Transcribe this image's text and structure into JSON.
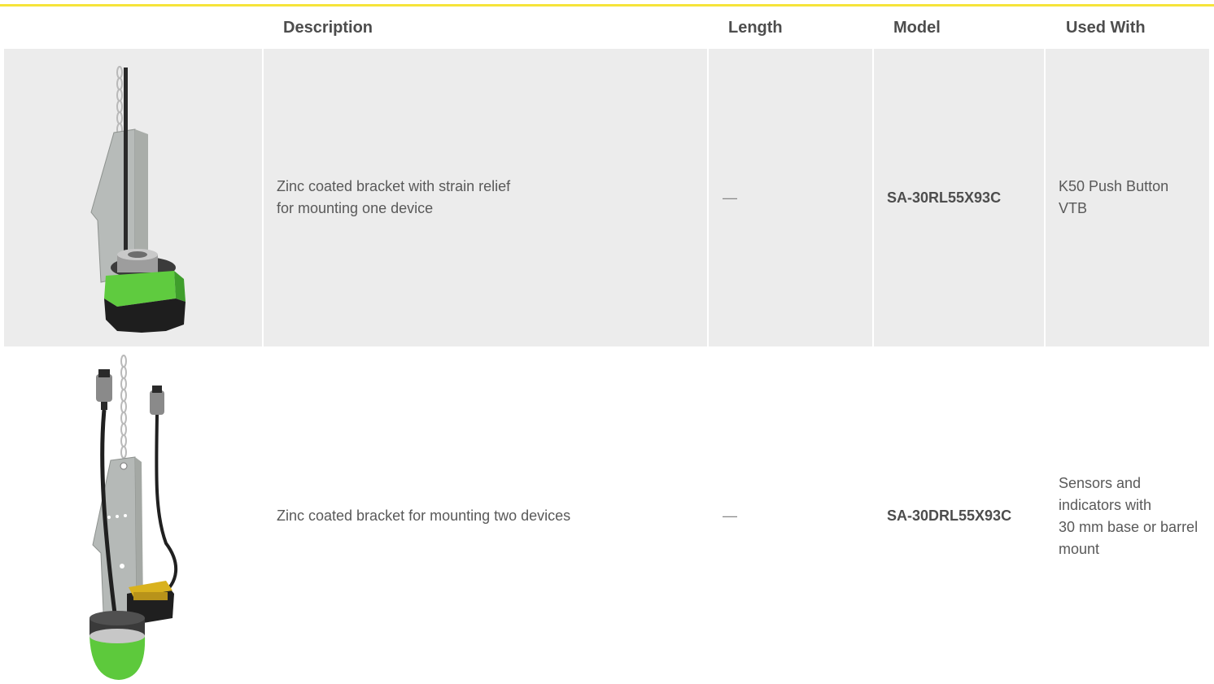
{
  "header": {
    "description": "Description",
    "length": "Length",
    "model": "Model",
    "used_with": "Used With"
  },
  "rows": [
    {
      "image_icon": "single-device-bracket-image",
      "description": "Zinc coated bracket with strain relief\nfor mounting one device",
      "length": "—",
      "model": "SA-30RL55X93C",
      "used_with": "K50 Push Button\nVTB"
    },
    {
      "image_icon": "dual-device-bracket-image",
      "description": "Zinc coated bracket for mounting two devices",
      "length": "—",
      "model": "SA-30DRL55X93C",
      "used_with": "Sensors and\nindicators with\n30 mm base or barrel\nmount"
    }
  ],
  "colors": {
    "accent_rule": "#f6e43a",
    "row_shade": "#ececec",
    "device_green": "#59c93a"
  }
}
